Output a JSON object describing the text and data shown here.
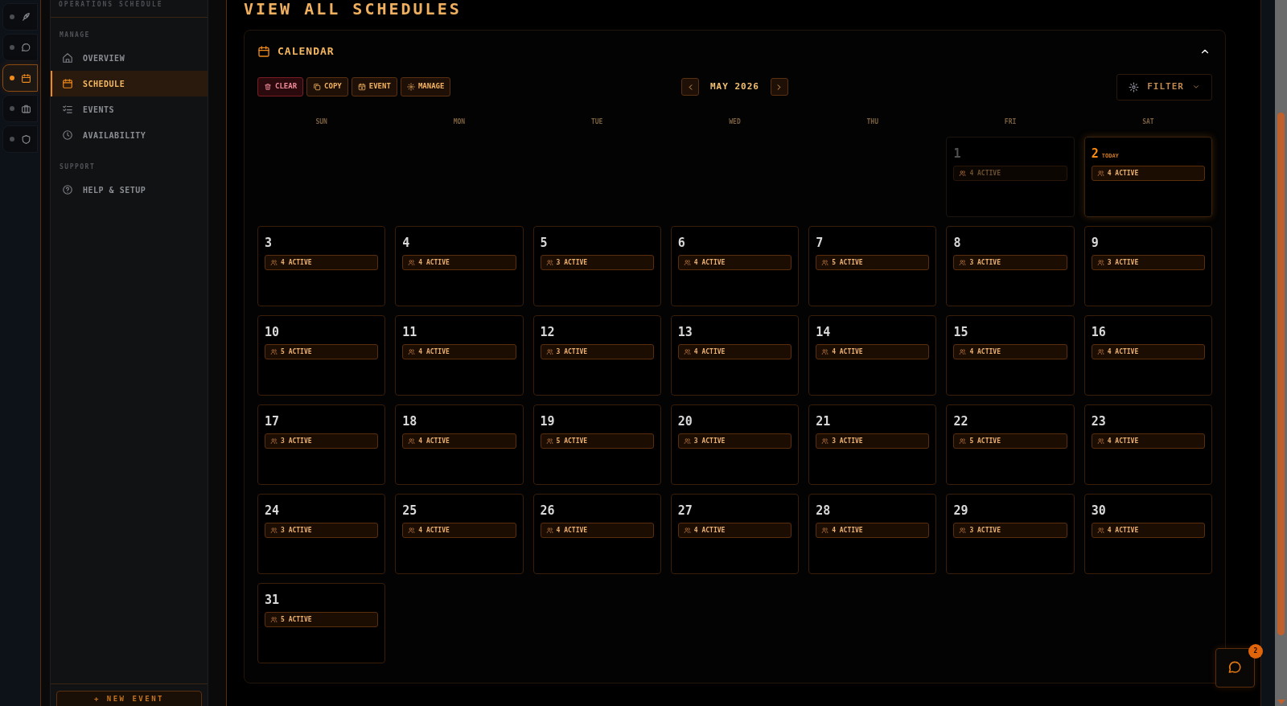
{
  "rail": [
    {
      "selected": false
    },
    {
      "selected": false
    },
    {
      "selected": true
    },
    {
      "selected": false
    },
    {
      "selected": false
    }
  ],
  "sidebar": {
    "title": "OPERATIONS SCHEDULE",
    "sections": [
      {
        "heading": "MANAGE",
        "items": [
          {
            "label": "OVERVIEW",
            "selected": false
          },
          {
            "label": "SCHEDULE",
            "selected": true
          },
          {
            "label": "EVENTS",
            "selected": false
          },
          {
            "label": "AVAILABILITY",
            "selected": false
          }
        ]
      },
      {
        "heading": "SUPPORT",
        "items": [
          {
            "label": "HELP & SETUP",
            "selected": false
          }
        ]
      }
    ],
    "footer_button": "+ NEW EVENT"
  },
  "page_title": "VIEW ALL SCHEDULES",
  "calendar": {
    "title": "CALENDAR",
    "actions": [
      {
        "label": "CLEAR",
        "kind": "danger"
      },
      {
        "label": "COPY",
        "kind": "normal"
      },
      {
        "label": "EVENT",
        "kind": "normal"
      },
      {
        "label": "MANAGE",
        "kind": "normal"
      }
    ],
    "month": "MAY 2026",
    "filter": "FILTER",
    "weekdays": [
      "SUN",
      "MON",
      "TUE",
      "WED",
      "THU",
      "FRI",
      "SAT"
    ],
    "days": [
      {
        "kind": "blank"
      },
      {
        "kind": "blank"
      },
      {
        "kind": "blank"
      },
      {
        "kind": "blank"
      },
      {
        "kind": "blank"
      },
      {
        "day": "1",
        "badge": "4 ACTIVE",
        "past": true,
        "today": false
      },
      {
        "day": "2",
        "badge": "4 ACTIVE",
        "past": false,
        "today": true,
        "note": "TODAY"
      },
      {
        "day": "3",
        "badge": "4 ACTIVE",
        "past": false,
        "today": false
      },
      {
        "day": "4",
        "badge": "4 ACTIVE",
        "past": false,
        "today": false
      },
      {
        "day": "5",
        "badge": "3 ACTIVE",
        "past": false,
        "today": false
      },
      {
        "day": "6",
        "badge": "4 ACTIVE",
        "past": false,
        "today": false
      },
      {
        "day": "7",
        "badge": "5 ACTIVE",
        "past": false,
        "today": false
      },
      {
        "day": "8",
        "badge": "3 ACTIVE",
        "past": false,
        "today": false
      },
      {
        "day": "9",
        "badge": "3 ACTIVE",
        "past": false,
        "today": false
      },
      {
        "day": "10",
        "badge": "5 ACTIVE",
        "past": false,
        "today": false
      },
      {
        "day": "11",
        "badge": "4 ACTIVE",
        "past": false,
        "today": false
      },
      {
        "day": "12",
        "badge": "3 ACTIVE",
        "past": false,
        "today": false
      },
      {
        "day": "13",
        "badge": "4 ACTIVE",
        "past": false,
        "today": false
      },
      {
        "day": "14",
        "badge": "4 ACTIVE",
        "past": false,
        "today": false
      },
      {
        "day": "15",
        "badge": "4 ACTIVE",
        "past": false,
        "today": false
      },
      {
        "day": "16",
        "badge": "4 ACTIVE",
        "past": false,
        "today": false
      },
      {
        "day": "17",
        "badge": "3 ACTIVE",
        "past": false,
        "today": false
      },
      {
        "day": "18",
        "badge": "4 ACTIVE",
        "past": false,
        "today": false
      },
      {
        "day": "19",
        "badge": "5 ACTIVE",
        "past": false,
        "today": false
      },
      {
        "day": "20",
        "badge": "3 ACTIVE",
        "past": false,
        "today": false
      },
      {
        "day": "21",
        "badge": "3 ACTIVE",
        "past": false,
        "today": false
      },
      {
        "day": "22",
        "badge": "5 ACTIVE",
        "past": false,
        "today": false
      },
      {
        "day": "23",
        "badge": "4 ACTIVE",
        "past": false,
        "today": false
      },
      {
        "day": "24",
        "badge": "3 ACTIVE",
        "past": false,
        "today": false
      },
      {
        "day": "25",
        "badge": "4 ACTIVE",
        "past": false,
        "today": false
      },
      {
        "day": "26",
        "badge": "4 ACTIVE",
        "past": false,
        "today": false
      },
      {
        "day": "27",
        "badge": "4 ACTIVE",
        "past": false,
        "today": false
      },
      {
        "day": "28",
        "badge": "4 ACTIVE",
        "past": false,
        "today": false
      },
      {
        "day": "29",
        "badge": "3 ACTIVE",
        "past": false,
        "today": false
      },
      {
        "day": "30",
        "badge": "4 ACTIVE",
        "past": false,
        "today": false
      },
      {
        "day": "31",
        "badge": "5 ACTIVE",
        "past": false,
        "today": false
      }
    ]
  },
  "chat": {
    "badge": "2"
  }
}
